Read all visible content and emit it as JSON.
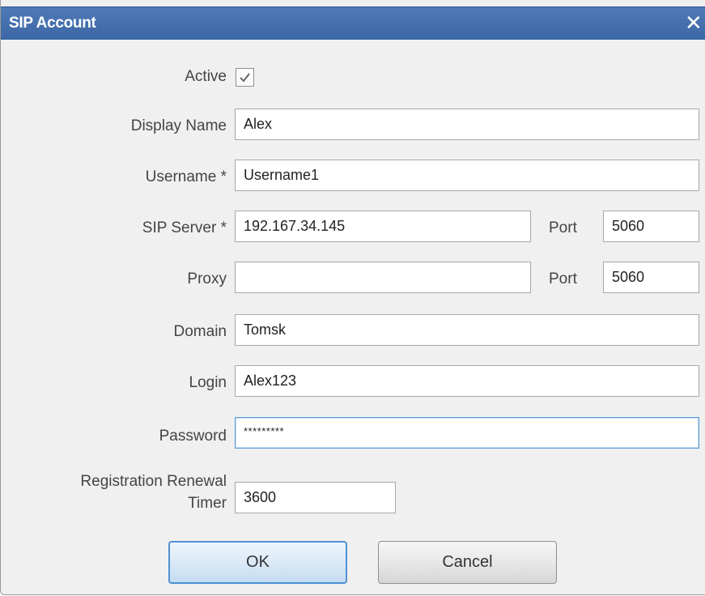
{
  "dialog": {
    "title": "SIP Account",
    "close_icon": "close-icon"
  },
  "form": {
    "active_label": "Active",
    "active_checked": true,
    "display_name_label": "Display Name",
    "display_name_value": "Alex",
    "username_label": "Username *",
    "username_value": "Username1",
    "sip_server_label": "SIP Server *",
    "sip_server_value": "192.167.34.145",
    "sip_port_label": "Port",
    "sip_port_value": "5060",
    "proxy_label": "Proxy",
    "proxy_value": "",
    "proxy_port_label": "Port",
    "proxy_port_value": "5060",
    "domain_label": "Domain",
    "domain_value": "Tomsk",
    "login_label": "Login",
    "login_value": "Alex123",
    "password_label": "Password",
    "password_value": "*********",
    "renewal_label_line1": "Registration Renewal",
    "renewal_label_line2": "Timer",
    "renewal_value": "3600"
  },
  "buttons": {
    "ok_label": "OK",
    "cancel_label": "Cancel"
  }
}
